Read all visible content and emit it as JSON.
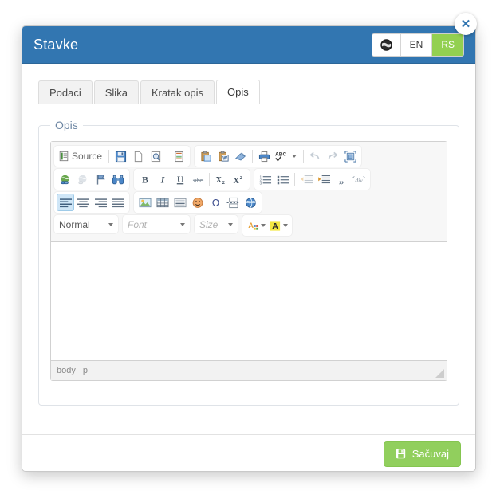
{
  "modal": {
    "title": "Stavke",
    "close_label": "✕",
    "close_icon": "close-icon"
  },
  "language_switch": {
    "globe_icon": "globe-icon",
    "options": [
      {
        "label": "EN",
        "active": false
      },
      {
        "label": "RS",
        "active": true
      }
    ],
    "active_color": "#93d051"
  },
  "tabs": [
    {
      "label": "Podaci",
      "active": false
    },
    {
      "label": "Slika",
      "active": false
    },
    {
      "label": "Kratak opis",
      "active": false
    },
    {
      "label": "Opis",
      "active": true
    }
  ],
  "fieldset": {
    "legend": "Opis"
  },
  "editor": {
    "source_label": "Source",
    "toolbar_rows": [
      {
        "groups": [
          {
            "buttons": [
              {
                "name": "source-button",
                "label": "Source",
                "icon": "source-icon",
                "disabled": false
              },
              {
                "name": "separator",
                "label": "",
                "icon": "separator",
                "disabled": false
              },
              {
                "name": "save-button",
                "label": "",
                "icon": "floppy-icon",
                "disabled": false
              },
              {
                "name": "new-page-button",
                "label": "",
                "icon": "new-page-icon",
                "disabled": false
              },
              {
                "name": "preview-button",
                "label": "",
                "icon": "preview-icon",
                "disabled": false
              },
              {
                "name": "separator",
                "label": "",
                "icon": "separator",
                "disabled": false
              },
              {
                "name": "templates-button",
                "label": "",
                "icon": "templates-icon",
                "disabled": false
              }
            ]
          },
          {
            "buttons": [
              {
                "name": "paste-button",
                "label": "",
                "icon": "paste-icon",
                "disabled": false
              },
              {
                "name": "paste-from-word-button",
                "label": "",
                "icon": "paste-word-icon",
                "disabled": false
              },
              {
                "name": "paste-as-plain-text-button",
                "label": "",
                "icon": "eraser-icon",
                "disabled": false
              },
              {
                "name": "separator",
                "label": "",
                "icon": "separator",
                "disabled": false
              },
              {
                "name": "print-button",
                "label": "",
                "icon": "printer-icon",
                "disabled": false
              },
              {
                "name": "spellcheck-button",
                "label": "",
                "icon": "spellcheck-icon",
                "disabled": false
              },
              {
                "name": "separator",
                "label": "",
                "icon": "separator",
                "disabled": false
              },
              {
                "name": "undo-button",
                "label": "",
                "icon": "undo-icon",
                "disabled": true
              },
              {
                "name": "redo-button",
                "label": "",
                "icon": "redo-icon",
                "disabled": true
              },
              {
                "name": "maximize-button",
                "label": "",
                "icon": "maximize-icon",
                "disabled": false
              }
            ]
          }
        ]
      },
      {
        "groups": [
          {
            "buttons": [
              {
                "name": "link-button",
                "label": "",
                "icon": "link-icon",
                "disabled": false
              },
              {
                "name": "unlink-button",
                "label": "",
                "icon": "unlink-icon",
                "disabled": true
              },
              {
                "name": "anchor-button",
                "label": "",
                "icon": "anchor-flag-icon",
                "disabled": false
              },
              {
                "name": "find-button",
                "label": "",
                "icon": "binoculars-icon",
                "disabled": false
              }
            ]
          },
          {
            "buttons": [
              {
                "name": "bold-button",
                "label": "B",
                "icon": "bold-icon",
                "disabled": false
              },
              {
                "name": "italic-button",
                "label": "I",
                "icon": "italic-icon",
                "disabled": false
              },
              {
                "name": "underline-button",
                "label": "U",
                "icon": "underline-icon",
                "disabled": false
              },
              {
                "name": "strikethrough-button",
                "label": "abc",
                "icon": "strikethrough-icon",
                "disabled": false
              },
              {
                "name": "separator",
                "label": "",
                "icon": "separator",
                "disabled": false
              },
              {
                "name": "subscript-button",
                "label": "X2",
                "icon": "subscript-icon",
                "disabled": false
              },
              {
                "name": "superscript-button",
                "label": "X2",
                "icon": "superscript-icon",
                "disabled": false
              }
            ]
          },
          {
            "buttons": [
              {
                "name": "numbered-list-button",
                "label": "",
                "icon": "numbered-list-icon",
                "disabled": false
              },
              {
                "name": "bulleted-list-button",
                "label": "",
                "icon": "bulleted-list-icon",
                "disabled": false
              },
              {
                "name": "separator",
                "label": "",
                "icon": "separator",
                "disabled": false
              },
              {
                "name": "outdent-button",
                "label": "",
                "icon": "outdent-icon",
                "disabled": true
              },
              {
                "name": "indent-button",
                "label": "",
                "icon": "indent-icon",
                "disabled": false
              },
              {
                "name": "blockquote-button",
                "label": "",
                "icon": "blockquote-icon",
                "disabled": false
              },
              {
                "name": "create-div-button",
                "label": "",
                "icon": "div-container-icon",
                "disabled": false
              }
            ]
          }
        ]
      },
      {
        "groups": [
          {
            "buttons": [
              {
                "name": "align-left-button",
                "label": "",
                "icon": "align-left-icon",
                "disabled": false,
                "active": true
              },
              {
                "name": "align-center-button",
                "label": "",
                "icon": "align-center-icon",
                "disabled": false
              },
              {
                "name": "align-right-button",
                "label": "",
                "icon": "align-right-icon",
                "disabled": false
              },
              {
                "name": "align-justify-button",
                "label": "",
                "icon": "align-justify-icon",
                "disabled": false
              }
            ]
          },
          {
            "buttons": [
              {
                "name": "image-button",
                "label": "",
                "icon": "image-icon",
                "disabled": false
              },
              {
                "name": "table-button",
                "label": "",
                "icon": "table-icon",
                "disabled": false
              },
              {
                "name": "horizontal-rule-button",
                "label": "",
                "icon": "horizontal-rule-icon",
                "disabled": false
              },
              {
                "name": "smiley-button",
                "label": "",
                "icon": "smiley-icon",
                "disabled": false
              },
              {
                "name": "special-character-button",
                "label": "Ω",
                "icon": "omega-icon",
                "disabled": false
              },
              {
                "name": "page-break-button",
                "label": "",
                "icon": "page-break-icon",
                "disabled": false
              },
              {
                "name": "iframe-button",
                "label": "",
                "icon": "iframe-globe-icon",
                "disabled": false
              }
            ]
          }
        ]
      }
    ],
    "combos": {
      "format": {
        "value": "Normal",
        "placeholder": false
      },
      "font": {
        "value": "Font",
        "placeholder": true
      },
      "size": {
        "value": "Size",
        "placeholder": true
      }
    },
    "color_buttons": [
      {
        "name": "text-color-button",
        "label": "A",
        "icon": "text-color-icon"
      },
      {
        "name": "background-color-button",
        "label": "A",
        "icon": "background-color-icon"
      }
    ],
    "content": "",
    "elements_path": [
      "body",
      "p"
    ]
  },
  "footer": {
    "save_label": "Sačuvaj",
    "save_icon": "floppy-icon",
    "save_color": "#91cf5d"
  }
}
